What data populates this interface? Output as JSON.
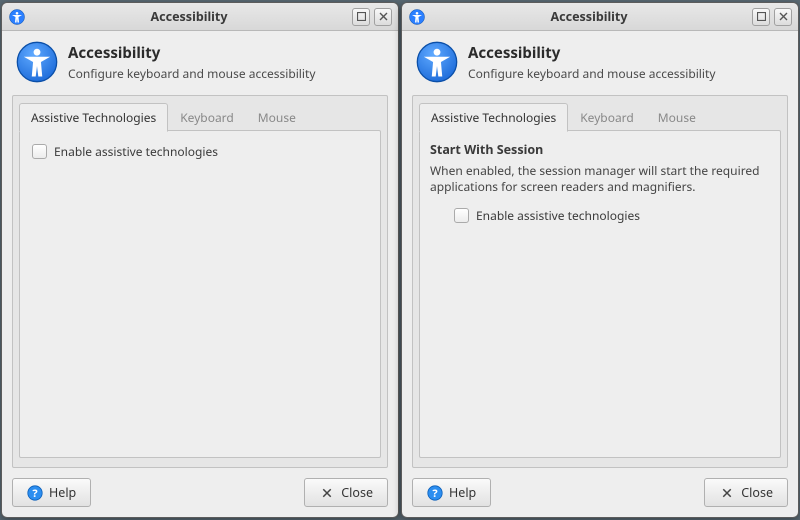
{
  "left": {
    "titlebar": {
      "title": "Accessibility"
    },
    "header": {
      "title": "Accessibility",
      "subtitle": "Configure keyboard and mouse accessibility"
    },
    "tabs": [
      {
        "label": "Assistive Technologies",
        "active": true
      },
      {
        "label": "Keyboard",
        "active": false
      },
      {
        "label": "Mouse",
        "active": false
      }
    ],
    "content": {
      "checkbox_label": "Enable assistive technologies"
    },
    "buttons": {
      "help": "Help",
      "close": "Close"
    }
  },
  "right": {
    "titlebar": {
      "title": "Accessibility"
    },
    "header": {
      "title": "Accessibility",
      "subtitle": "Configure keyboard and mouse accessibility"
    },
    "tabs": [
      {
        "label": "Assistive Technologies",
        "active": true
      },
      {
        "label": "Keyboard",
        "active": false
      },
      {
        "label": "Mouse",
        "active": false
      }
    ],
    "content": {
      "section_title": "Start With Session",
      "section_desc": "When enabled, the session manager will start the required applications for screen readers and magnifiers.",
      "checkbox_label": "Enable assistive technologies"
    },
    "buttons": {
      "help": "Help",
      "close": "Close"
    }
  },
  "colors": {
    "accent_blue": "#2b7fff",
    "help_blue": "#2c8ef0"
  }
}
